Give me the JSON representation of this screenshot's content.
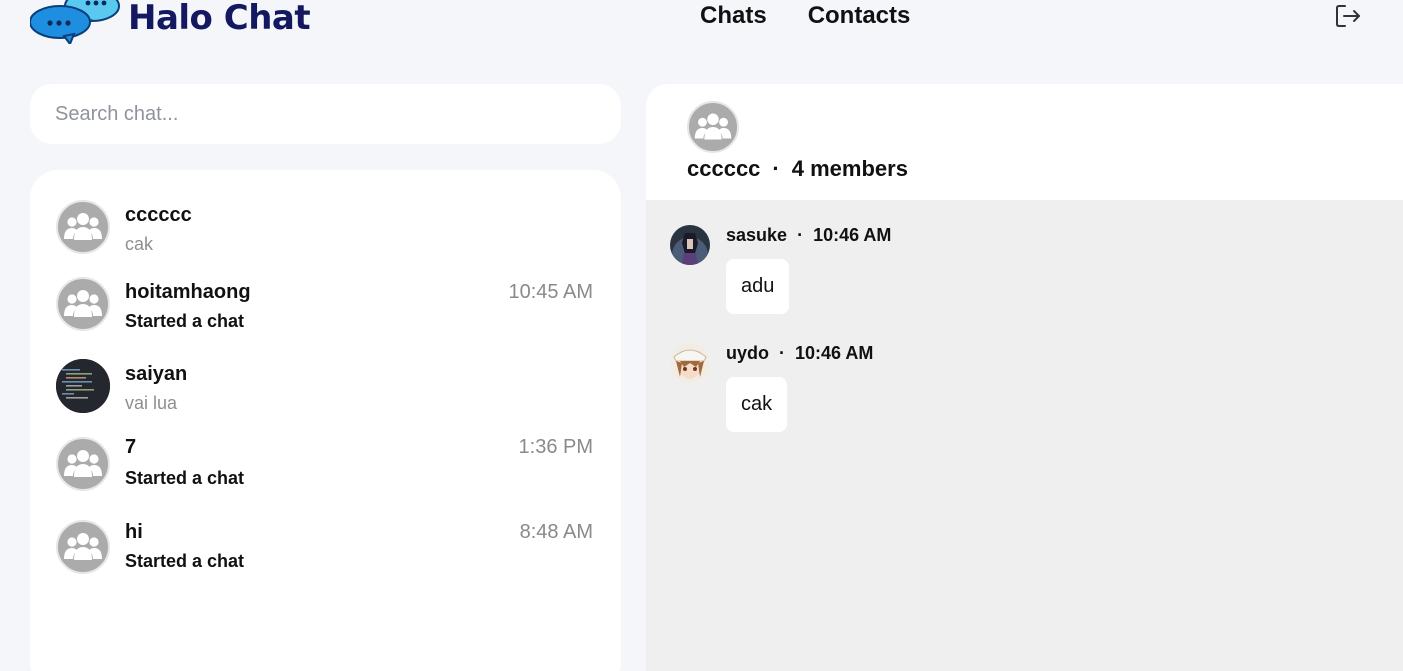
{
  "app": {
    "name": "Halo Chat"
  },
  "nav": {
    "chats": "Chats",
    "contacts": "Contacts"
  },
  "search": {
    "placeholder": "Search chat..."
  },
  "chats": [
    {
      "name": "cccccc",
      "preview": "cak",
      "time": "",
      "avatar": "group-icon",
      "preview_style": "muted"
    },
    {
      "name": "hoitamhaong",
      "preview": "Started a chat",
      "time": "10:45 AM",
      "avatar": "group-icon",
      "preview_style": "bold"
    },
    {
      "name": "saiyan",
      "preview": "vai lua",
      "time": "",
      "avatar": "code-screenshot-photo",
      "preview_style": "muted"
    },
    {
      "name": "7",
      "preview": "Started a chat",
      "time": "1:36 PM",
      "avatar": "group-icon",
      "preview_style": "bold"
    },
    {
      "name": "hi",
      "preview": "Started a chat",
      "time": "8:48 AM",
      "avatar": "group-icon",
      "preview_style": "bold"
    }
  ],
  "conversation": {
    "name": "cccccc",
    "separator": "·",
    "members": "4 members",
    "messages": [
      {
        "sender": "sasuke",
        "time": "10:46 AM",
        "text": "adu",
        "avatar": "sasuke-avatar"
      },
      {
        "sender": "uydo",
        "time": "10:46 AM",
        "text": "cak",
        "avatar": "anime-girl-avatar"
      }
    ]
  },
  "colors": {
    "background": "#f5f6fa",
    "brand": "#141861",
    "logo_bubble_blue": "#1d8ee0",
    "logo_bubble_light": "#5bc8ef",
    "group_avatar": "#ababab",
    "message_area": "#efefef",
    "muted_text": "#8f8f8f"
  }
}
